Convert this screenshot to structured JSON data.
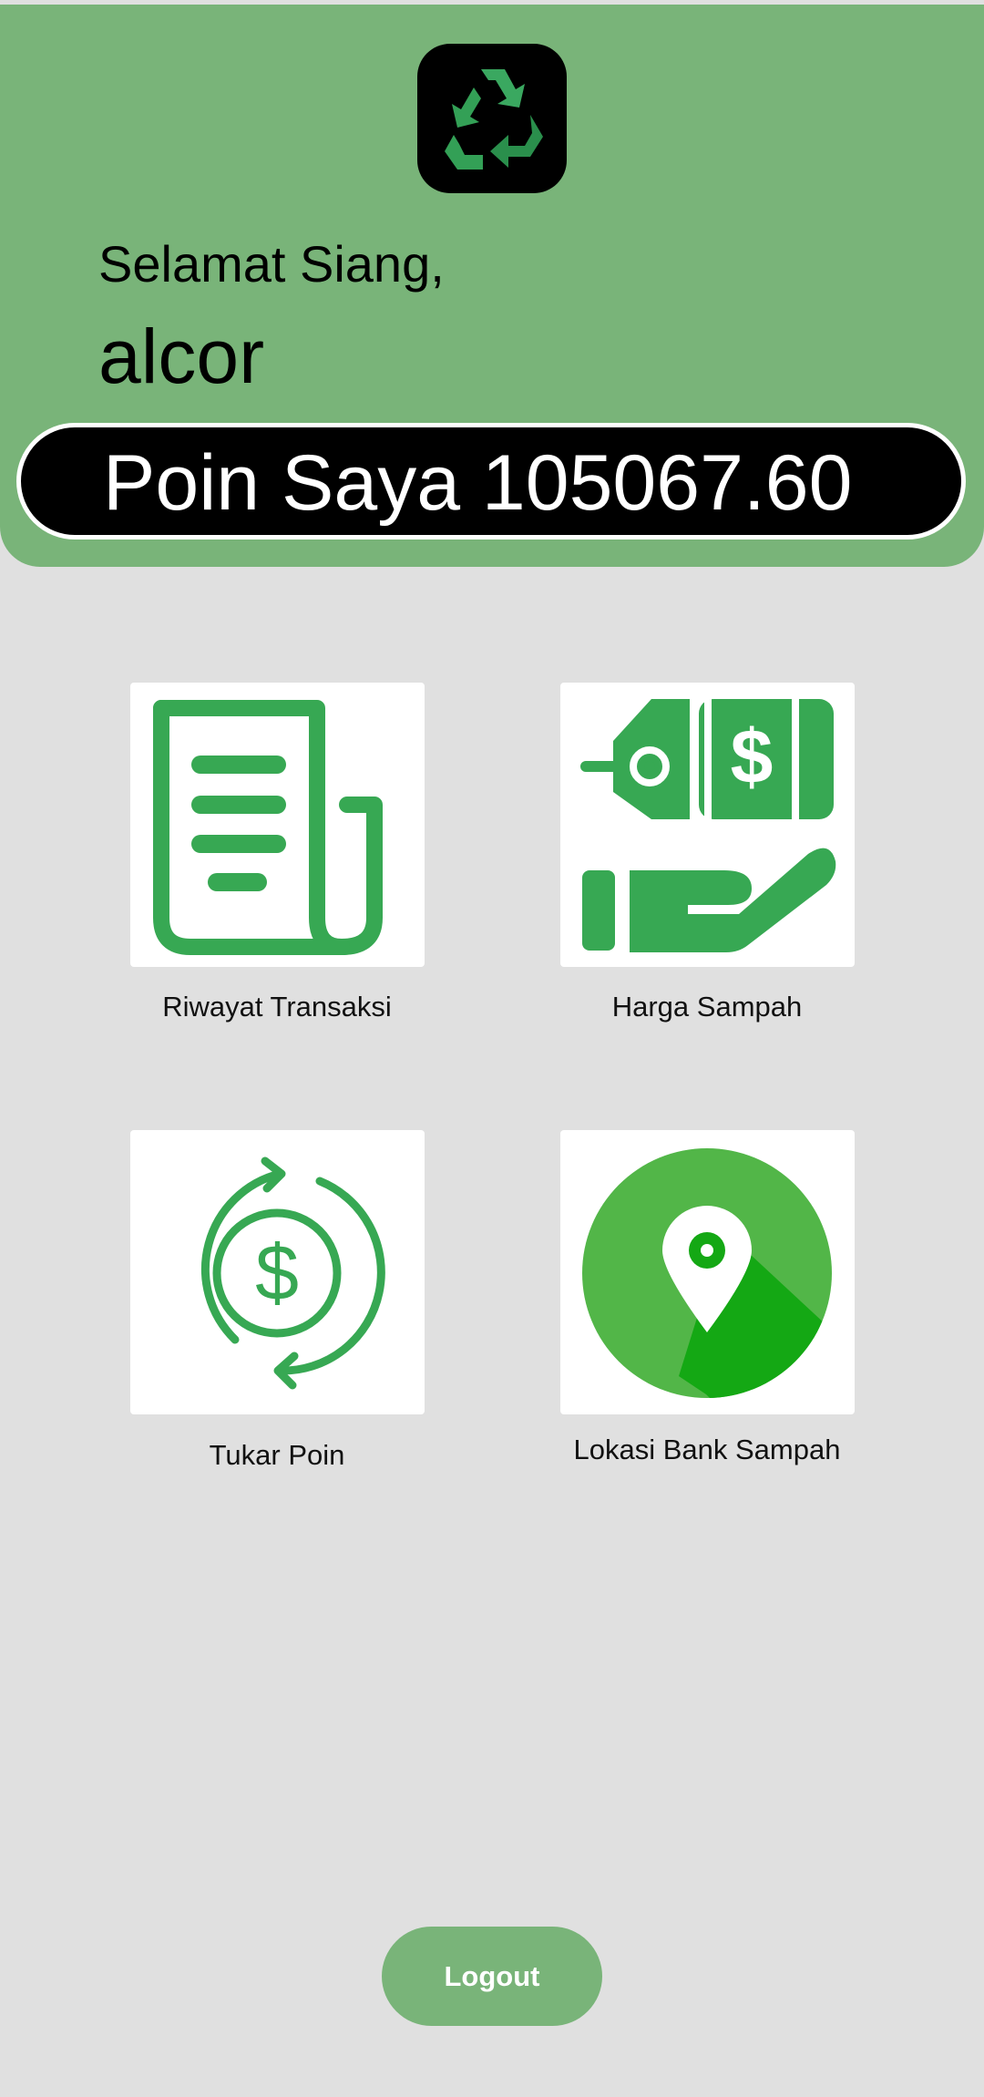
{
  "header": {
    "logo_icon": "recycle-icon",
    "greeting": "Selamat Siang,",
    "username": "alcor",
    "points_text": "Poin Saya 105067.60"
  },
  "menu": [
    {
      "label": "Riwayat Transaksi",
      "icon": "receipt-icon"
    },
    {
      "label": "Harga Sampah",
      "icon": "price-tag-hand-icon"
    },
    {
      "label": "Tukar Poin",
      "icon": "exchange-coin-icon"
    },
    {
      "label": "Lokasi Bank Sampah",
      "icon": "location-pin-icon"
    }
  ],
  "logout_label": "Logout",
  "colors": {
    "header_green": "#79b479",
    "icon_green": "#37a853",
    "background": "#e0e0e0"
  }
}
